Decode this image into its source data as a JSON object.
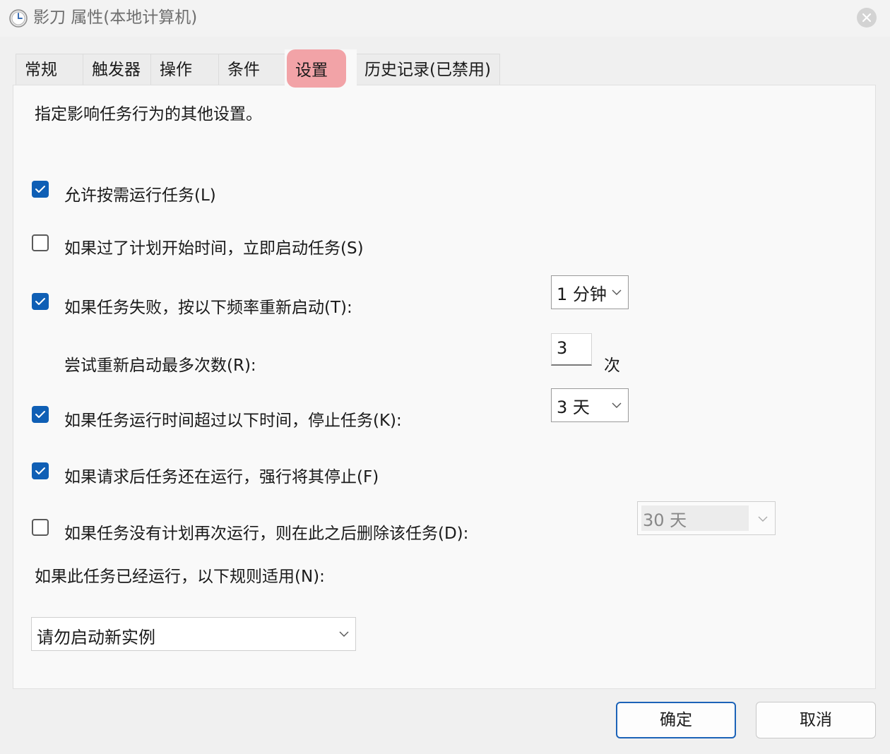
{
  "window": {
    "title": "影刀 属性(本地计算机)",
    "icon": "clock-icon"
  },
  "tabs": [
    {
      "label": "常规"
    },
    {
      "label": "触发器"
    },
    {
      "label": "操作"
    },
    {
      "label": "条件"
    },
    {
      "label": "设置",
      "active": true
    },
    {
      "label": "历史记录(已禁用)"
    }
  ],
  "settings": {
    "description": "指定影响任务行为的其他设置。",
    "allow_on_demand": {
      "label": "允许按需运行任务(L)",
      "checked": true
    },
    "run_missed": {
      "label": "如果过了计划开始时间，立即启动任务(S)",
      "checked": false
    },
    "restart_on_fail": {
      "label": "如果任务失败，按以下频率重新启动(T):",
      "checked": true,
      "interval": "1 分钟"
    },
    "restart_attempts": {
      "label": "尝试重新启动最多次数(R):",
      "value": "3",
      "unit": "次"
    },
    "stop_if_long": {
      "label": "如果任务运行时间超过以下时间，停止任务(K):",
      "checked": true,
      "duration": "3 天"
    },
    "force_stop": {
      "label": "如果请求后任务还在运行，强行将其停止(F)",
      "checked": true
    },
    "delete_if_not_scheduled": {
      "label": "如果任务没有计划再次运行，则在此之后删除该任务(D):",
      "checked": false,
      "after": "30 天",
      "enabled": false
    },
    "instance_rule_label": "如果此任务已经运行，以下规则适用(N):",
    "instance_rule_value": "请勿启动新实例"
  },
  "buttons": {
    "ok": "确定",
    "cancel": "取消"
  },
  "colors": {
    "accent": "#0f5fb5",
    "tab_highlight": "#f2a3a7",
    "primary_border": "#1c63b8"
  }
}
